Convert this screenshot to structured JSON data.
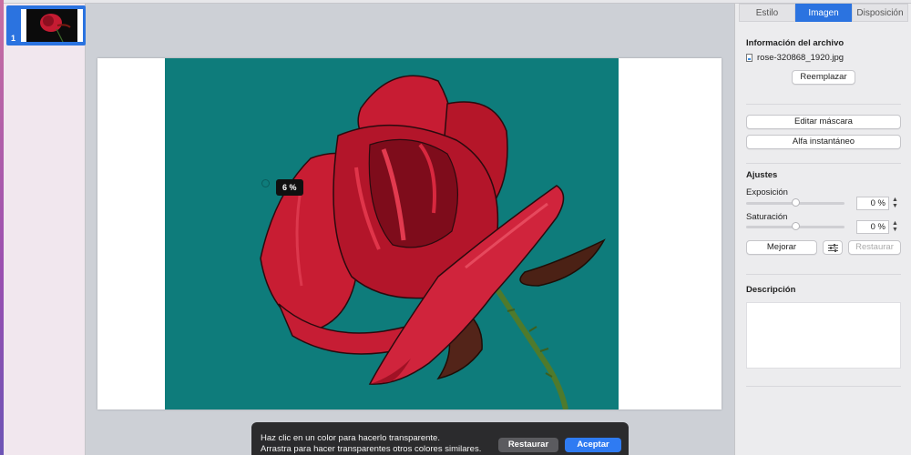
{
  "slide_navigator": {
    "slides": [
      {
        "number": "1"
      }
    ]
  },
  "canvas": {
    "opacity_tooltip": "6 %",
    "hint": {
      "line1": "Haz clic en un color para hacerlo transparente.",
      "line2": "Arrastra para hacer transparentes otros colores similares.",
      "restore_label": "Restaurar",
      "accept_label": "Aceptar"
    },
    "colors": {
      "backdrop": "#0e7c7b",
      "rose": "#c51b32",
      "accent": "#2f7bf2"
    }
  },
  "inspector": {
    "tabs": [
      {
        "label": "Estilo",
        "active": false
      },
      {
        "label": "Imagen",
        "active": true
      },
      {
        "label": "Disposición",
        "active": false
      }
    ],
    "file_info": {
      "title": "Información del archivo",
      "filename": "rose-320868_1920.jpg",
      "replace_label": "Reemplazar"
    },
    "edit_mask_label": "Editar máscara",
    "instant_alpha_label": "Alfa instantáneo",
    "adjustments": {
      "title": "Ajustes",
      "exposure": {
        "label": "Exposición",
        "value": "0 %",
        "level": 0.5
      },
      "saturation": {
        "label": "Saturación",
        "value": "0 %",
        "level": 0.5
      },
      "enhance_label": "Mejorar",
      "restore_label": "Restaurar"
    },
    "description": {
      "title": "Descripción"
    }
  }
}
